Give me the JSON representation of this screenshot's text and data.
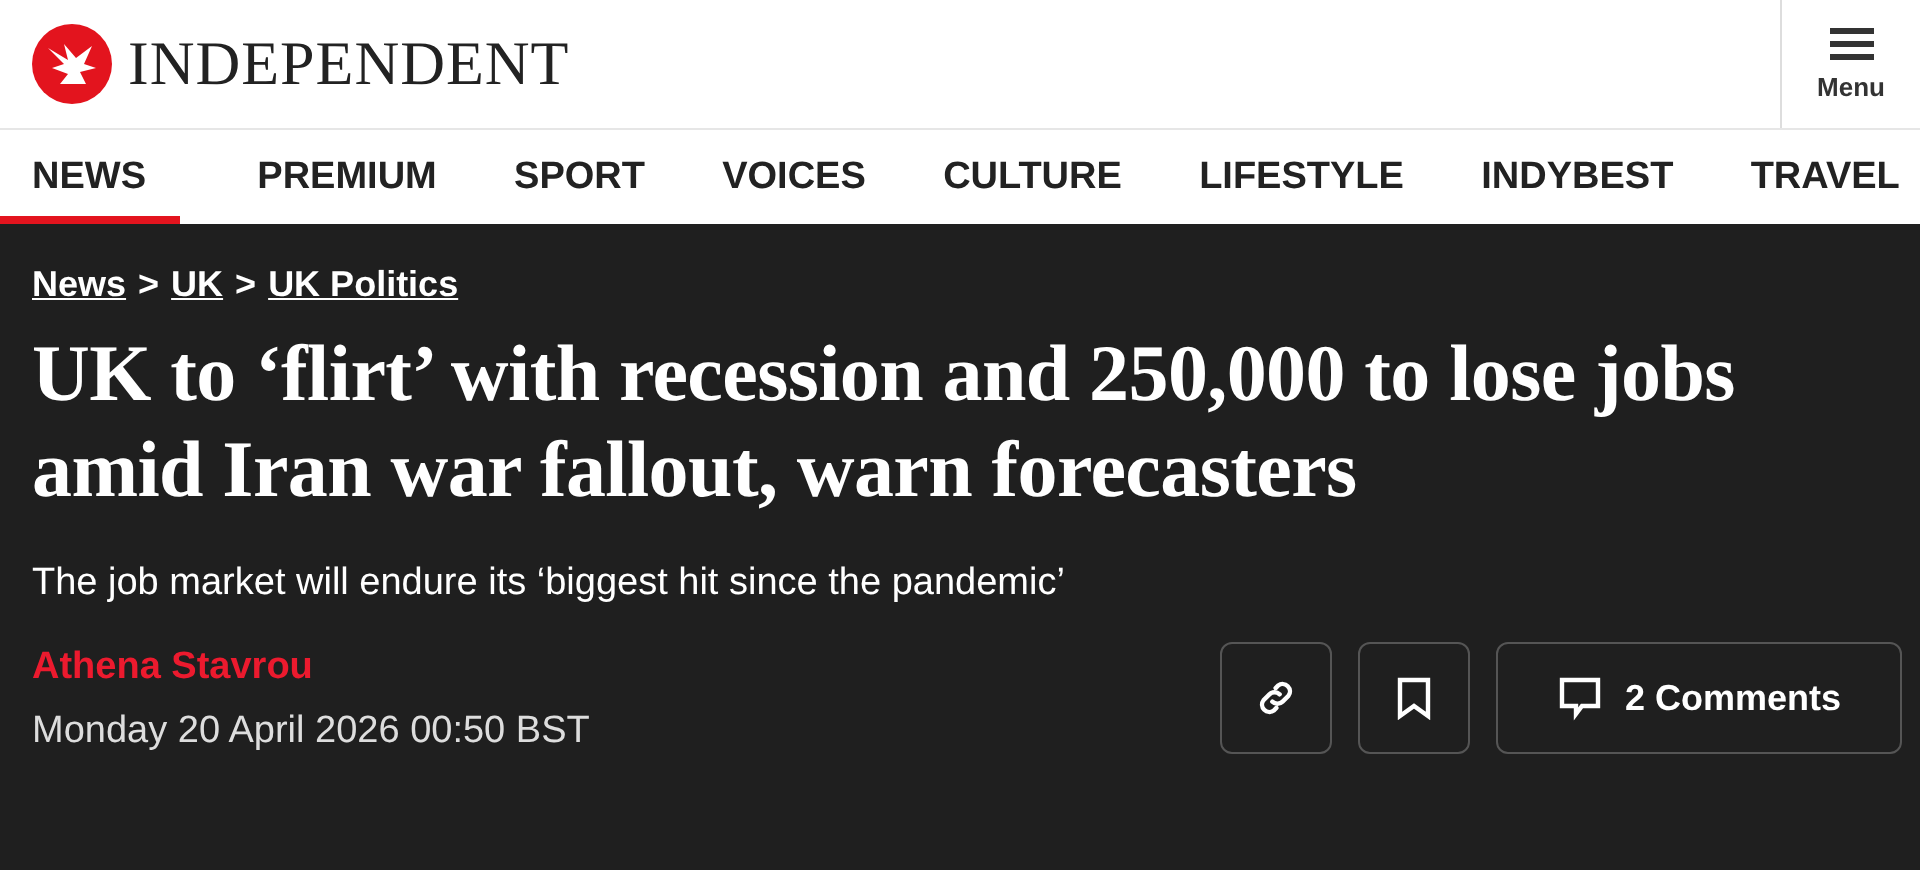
{
  "header": {
    "logo_text": "INDEPENDENT",
    "menu_label": "Menu"
  },
  "nav": [
    {
      "label": "NEWS",
      "selected": true
    },
    {
      "label": "PREMIUM",
      "selected": false
    },
    {
      "label": "SPORT",
      "selected": false
    },
    {
      "label": "VOICES",
      "selected": false
    },
    {
      "label": "CULTURE",
      "selected": false
    },
    {
      "label": "LIFESTYLE",
      "selected": false
    },
    {
      "label": "INDYBEST",
      "selected": false
    },
    {
      "label": "TRAVEL",
      "selected": false
    }
  ],
  "breadcrumbs": [
    "News",
    "UK",
    "UK Politics"
  ],
  "breadcrumb_separator": ">",
  "headline": "UK to ‘flirt’ with recession and 250,000 to lose jobs amid Iran war fallout, warn forecasters",
  "standfirst": "The job market will endure its ‘biggest hit since the pandemic’",
  "author": "Athena Stavrou",
  "date": "Monday 20 April 2026 00:50 BST",
  "actions": [
    {
      "kind": "link"
    },
    {
      "kind": "bookmark"
    },
    {
      "kind": "comments",
      "label": "2 Comments"
    }
  ]
}
